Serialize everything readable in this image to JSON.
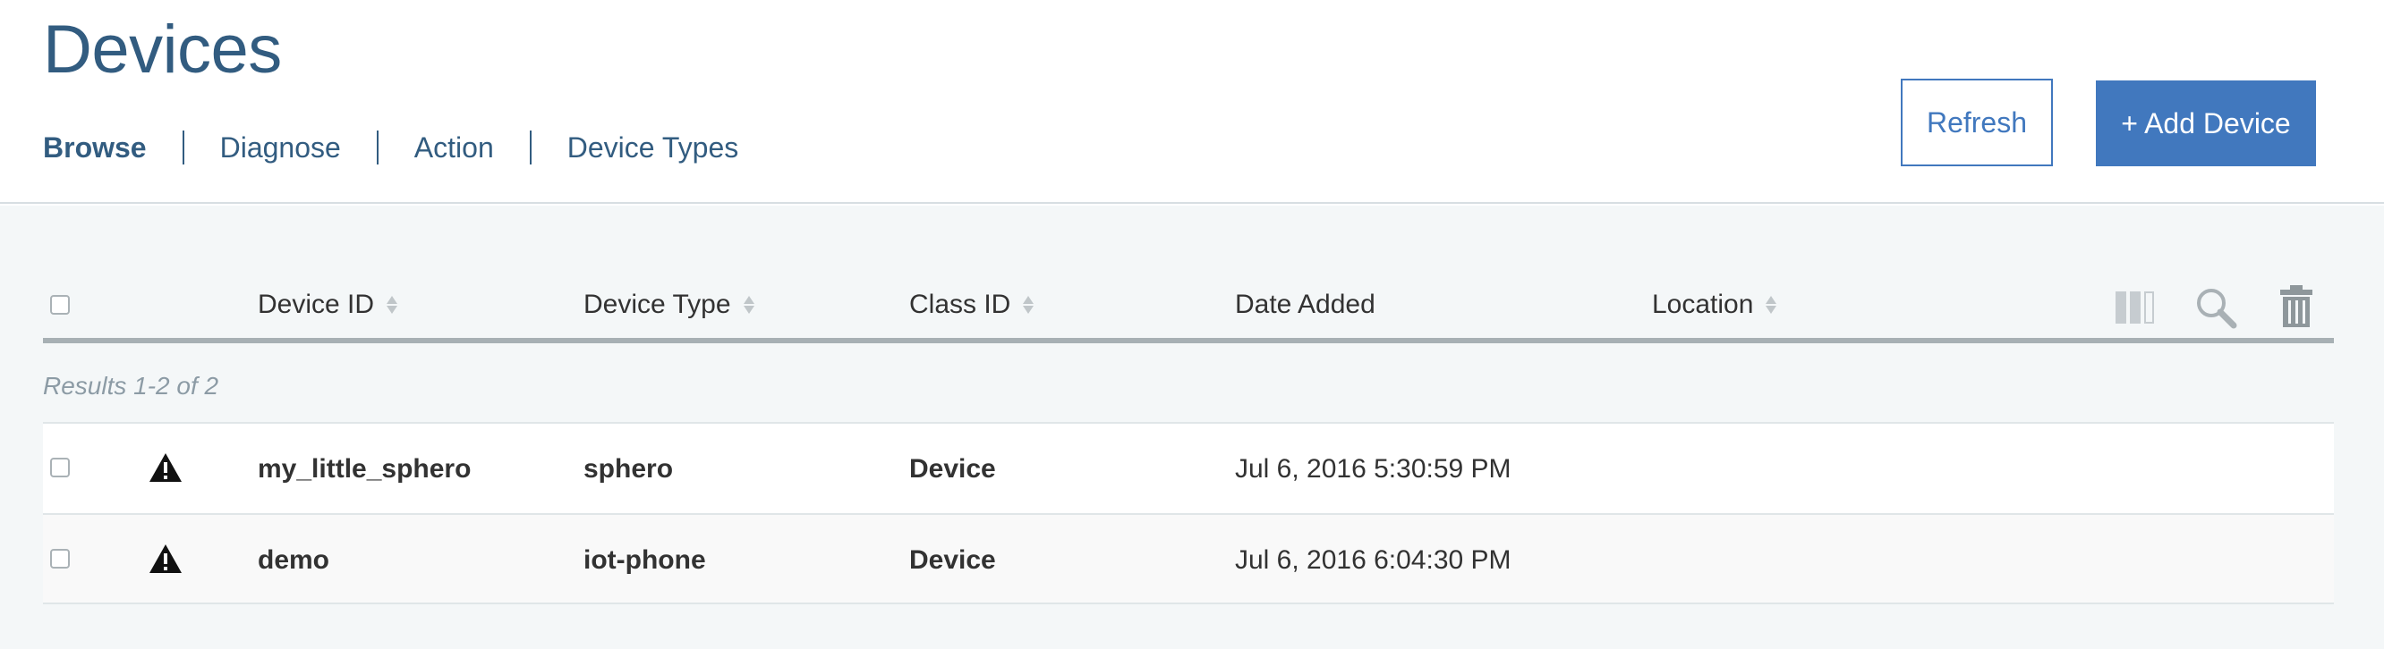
{
  "header": {
    "title": "Devices",
    "tabs": [
      {
        "label": "Browse",
        "active": true
      },
      {
        "label": "Diagnose",
        "active": false
      },
      {
        "label": "Action",
        "active": false
      },
      {
        "label": "Device Types",
        "active": false
      }
    ],
    "refresh_label": "Refresh",
    "add_label": "+ Add Device"
  },
  "table": {
    "columns": [
      "Device ID",
      "Device Type",
      "Class ID",
      "Date Added",
      "Location"
    ],
    "results_text": "Results 1-2 of 2",
    "toolbar_icons": [
      "columns-icon",
      "search-icon",
      "trash-icon"
    ],
    "rows": [
      {
        "device_id": "my_little_sphero",
        "device_type": "sphero",
        "class_id": "Device",
        "date_added": "Jul 6, 2016 5:30:59 PM",
        "location": "",
        "status_icon": "warning-icon"
      },
      {
        "device_id": "demo",
        "device_type": "iot-phone",
        "class_id": "Device",
        "date_added": "Jul 6, 2016 6:04:30 PM",
        "location": "",
        "status_icon": "warning-icon"
      }
    ]
  },
  "colors": {
    "brand": "#325c80",
    "accent": "#4178be",
    "content_bg": "#f4f7f8"
  }
}
